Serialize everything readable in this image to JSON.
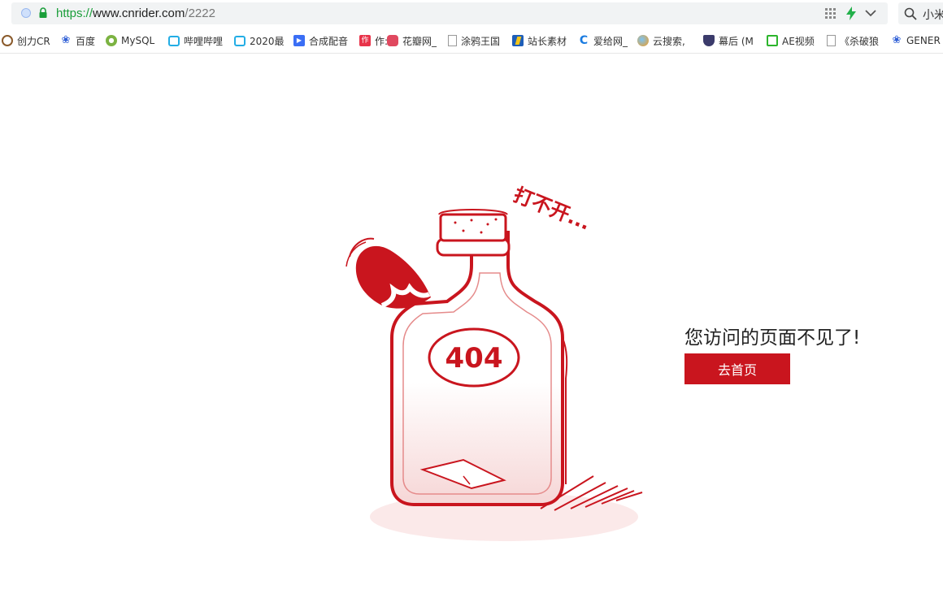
{
  "browser": {
    "url_scheme": "https://",
    "url_host": "www.cnrider.com",
    "url_path": "/2222",
    "search_text": "小米"
  },
  "bookmarks": [
    {
      "label": "创力CR",
      "icon": "globe-icon",
      "color": "#8a5a2b"
    },
    {
      "label": "百度",
      "icon": "baidu-paw-icon",
      "color": "#2f5fd6"
    },
    {
      "label": "MySQL",
      "icon": "mysql-icon",
      "color": "#7cb342"
    },
    {
      "label": "哔哩哔哩",
      "icon": "bilibili-icon",
      "color": "#23ade5"
    },
    {
      "label": "2020最",
      "icon": "bilibili-icon",
      "color": "#23ade5"
    },
    {
      "label": "合成配音",
      "icon": "play-icon",
      "color": "#3a6ef5"
    },
    {
      "label": "作:",
      "icon": "zuo-icon",
      "color": "#e8334a"
    },
    {
      "label": "花瓣网_",
      "icon": "huaban-icon",
      "color": "#e0485f"
    },
    {
      "label": "涂鸦王国",
      "icon": "page-icon",
      "color": "#999999"
    },
    {
      "label": "站长素材",
      "icon": "chinaz-icon",
      "color": "#1e5eb8"
    },
    {
      "label": "爱给网_",
      "icon": "aigei-icon",
      "color": "#1a7be0"
    },
    {
      "label": "云搜索,",
      "icon": "cloud-globe-icon",
      "color": "#f29c1f"
    },
    {
      "label": "幕后 (M",
      "icon": "shield-icon",
      "color": "#3b3b6b"
    },
    {
      "label": "AE视频",
      "icon": "video-icon",
      "color": "#2db52d"
    },
    {
      "label": "《杀破狼",
      "icon": "page-icon",
      "color": "#999999"
    },
    {
      "label": "GENER",
      "icon": "baidu-paw-icon",
      "color": "#2f5fd6"
    }
  ],
  "illustration": {
    "badge_text": "404",
    "caption": "打不开...",
    "accent_color": "#c9151e"
  },
  "message": "您访问的页面不见了!",
  "home_button_label": "去首页"
}
